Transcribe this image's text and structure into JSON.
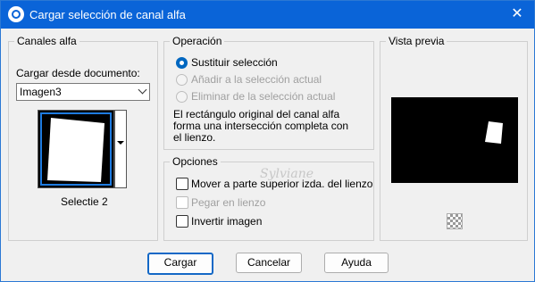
{
  "window": {
    "title": "Cargar selección de canal alfa"
  },
  "canales": {
    "legend": "Canales alfa",
    "load_label": "Cargar desde documento:",
    "document_value": "Imagen3",
    "thumb_caption": "Selectie 2"
  },
  "operacion": {
    "legend": "Operación",
    "options": [
      {
        "label": "Sustituir selección",
        "checked": true,
        "enabled": true
      },
      {
        "label": "Añadir a la selección actual",
        "checked": false,
        "enabled": false
      },
      {
        "label": "Eliminar de la selección actual",
        "checked": false,
        "enabled": false
      }
    ],
    "note_lines": [
      "El rectángulo original del canal alfa",
      "forma una intersección completa con",
      "el lienzo."
    ]
  },
  "opciones": {
    "legend": "Opciones",
    "items": [
      {
        "label": "Mover a parte superior izda. del lienzo",
        "enabled": true
      },
      {
        "label": "Pegar en lienzo",
        "enabled": false
      },
      {
        "label": "Invertir imagen",
        "enabled": true
      }
    ]
  },
  "vista_previa": {
    "legend": "Vista previa"
  },
  "watermark": "Sylviane",
  "buttons": {
    "load": "Cargar",
    "cancel": "Cancelar",
    "help": "Ayuda"
  },
  "colors": {
    "titlebar": "#0a64d8",
    "accent": "#0067c0"
  }
}
